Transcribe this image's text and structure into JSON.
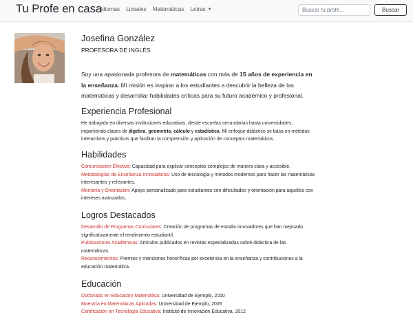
{
  "nav": {
    "brand": "Tu Profe en casa",
    "links": [
      "Idiomas",
      "Liceales",
      "Matemáticas",
      "Letras"
    ],
    "search_placeholder": "Buscar tu profe...",
    "search_button": "Buscar"
  },
  "profile": {
    "name": "Josefina González",
    "title": "PROFESORA DE INGLÉS",
    "intro": {
      "p1": "Soy una apasionada profesora de ",
      "b1": "matemáticas",
      "p2": " con más de ",
      "b2": "15 años de experiencia en la enseñanza.",
      "p3": " Mi misión es inspirar a los estudiantes a descubrir la belleza de las matemáticas y desarrollar habilidades críticas para su futuro académico y profesional."
    }
  },
  "experiencia": {
    "title": "Experiencia Profesional",
    "t1": "He trabajado en diversas instituciones educativas, desde escuelas secundarias hasta universidades, impartiendo clases de ",
    "b1": "álgebra",
    "t2": ", ",
    "b2": "geometría",
    "t3": ", ",
    "b3": "cálculo",
    "t4": " y ",
    "b4": "estadística",
    "t5": ". Mi enfoque didáctico se basa en métodos interactivos y prácticos que facilitan la comprensión y aplicación de conceptos matemáticos."
  },
  "habilidades": {
    "title": "Habilidades",
    "items": [
      {
        "label": "Comunicación Efectiva:",
        "text": " Capacidad para explicar conceptos complejos de manera clara y accesible."
      },
      {
        "label": "Metodologías de Enseñanza Innovadoras:",
        "text": " Uso de tecnología y métodos modernos para hacer las matemáticas interesantes y relevantes."
      },
      {
        "label": "Mentoría y Orientación:",
        "text": " Apoyo personalizado para estudiantes con dificultades y orientación para aquellos con intereses avanzados."
      }
    ]
  },
  "logros": {
    "title": "Logros Destacados",
    "items": [
      {
        "label": "Desarrollo de Programas Curriculares:",
        "text": " Creación de programas de estudio innovadores que han mejorado significativamente el rendimiento estudiantil."
      },
      {
        "label": "Publicaciones Académicas:",
        "text": " Artículos publicados en revistas especializadas sobre didáctica de las matemáticas."
      },
      {
        "label": "Reconocimientos:",
        "text": " Premios y menciones honoríficas por excelencia en la enseñanza y contribuciones a la educación matemática."
      }
    ]
  },
  "educacion": {
    "title": "Educación",
    "items": [
      {
        "label": "Doctorado en Educación Matemática:",
        "text": " Universidad de Ejemplo, 2010"
      },
      {
        "label": "Maestría en Matemáticas Aplicadas:",
        "text": " Universidad de Ejemplo, 2005"
      },
      {
        "label": "Certificación en Tecnología Educativa:",
        "text": " Instituto de Innovación Educativa, 2012"
      }
    ]
  },
  "colors": {
    "navbar_bg": "#f8f9fa",
    "highlight": "#c9302c",
    "text": "#212529"
  }
}
